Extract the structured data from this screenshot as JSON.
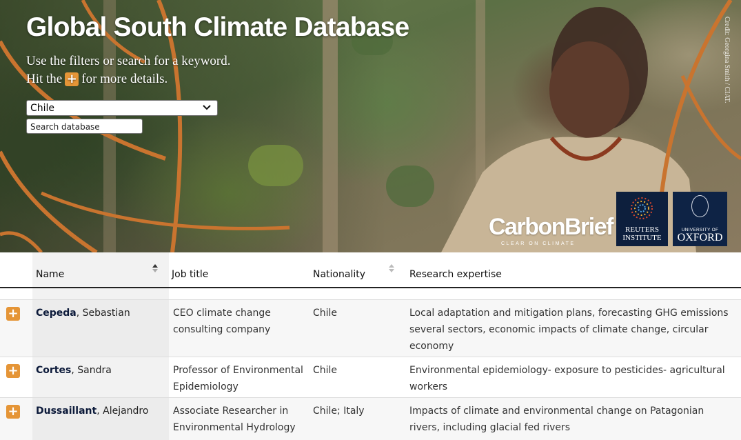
{
  "hero": {
    "title": "Global South Climate Database",
    "subtitle_line1": "Use the filters or search for a keyword.",
    "subtitle_line2_before": "Hit the",
    "subtitle_line2_after": "for more details.",
    "plus_symbol": "+",
    "credit": "Credit: Georgina Smith / CIAT.",
    "accent_color": "#e59537"
  },
  "filters": {
    "country_selected": "Chile",
    "search_placeholder": "Search database"
  },
  "logos": {
    "carbonbrief_name": "CarbonBrief",
    "carbonbrief_tagline": "CLEAR ON CLIMATE",
    "reuters_line1": "REUTERS",
    "reuters_line2": "INSTITUTE",
    "oxford_line1": "UNIVERSITY OF",
    "oxford_line2": "OXFORD"
  },
  "table": {
    "columns": [
      "Name",
      "Job title",
      "Nationality",
      "Research expertise"
    ],
    "rows": [
      {
        "surname": "Cepeda",
        "given": ", Sebastian",
        "job": "CEO climate change consulting company",
        "nationality": "Chile",
        "expertise": "Local adaptation and mitigation plans, forecasting GHG emissions several sectors, economic impacts of climate change, circular economy"
      },
      {
        "surname": "Cortes",
        "given": ", Sandra",
        "job": "Professor of Environmental Epidemiology",
        "nationality": "Chile",
        "expertise": "Environmental epidemiology- exposure to pesticides- agricultural workers"
      },
      {
        "surname": "Dussaillant",
        "given": ", Alejandro",
        "job": "Associate Researcher in Environmental Hydrology",
        "nationality": "Chile; Italy",
        "expertise": "Impacts of climate and environmental change on Patagonian rivers, including glacial fed rivers"
      }
    ]
  }
}
